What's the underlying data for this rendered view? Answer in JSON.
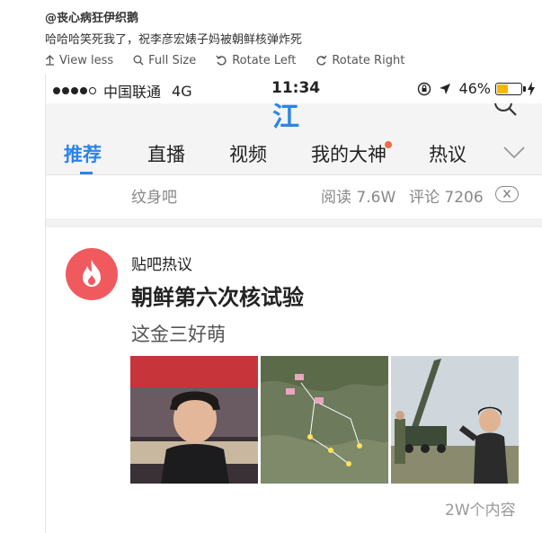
{
  "post": {
    "author": "@丧心病狂伊织鹅",
    "text": "哈哈哈笑死我了，祝李彦宏婊子妈被朝鲜核弹炸死",
    "actions": [
      {
        "label": "View less",
        "icon": "arrow-up-icon"
      },
      {
        "label": "Full Size",
        "icon": "magnifier-icon"
      },
      {
        "label": "Rotate Left",
        "icon": "rotate-left-icon"
      },
      {
        "label": "Rotate Right",
        "icon": "rotate-right-icon"
      }
    ]
  },
  "phone": {
    "status_bar": {
      "carrier": "中国联通",
      "network": "4G",
      "time": "11:34",
      "battery": "46%",
      "battery_level": 0.46,
      "battery_color": "#f5b800"
    },
    "tabs": [
      {
        "label": "推荐",
        "active": true
      },
      {
        "label": "直播"
      },
      {
        "label": "视频"
      },
      {
        "label": "我的大神",
        "badge_dot": true
      },
      {
        "label": "热议"
      }
    ],
    "meta": {
      "tag": "纹身吧",
      "reads": "阅读 7.6W",
      "comments": "评论 7206"
    },
    "card": {
      "source": "贴吧热议",
      "title": "朝鲜第六次核试验",
      "subtitle": "这金三好萌",
      "count": "2W个内容"
    },
    "accent_color": "#2c84e8",
    "hot_icon_color": "#f05a5f"
  }
}
